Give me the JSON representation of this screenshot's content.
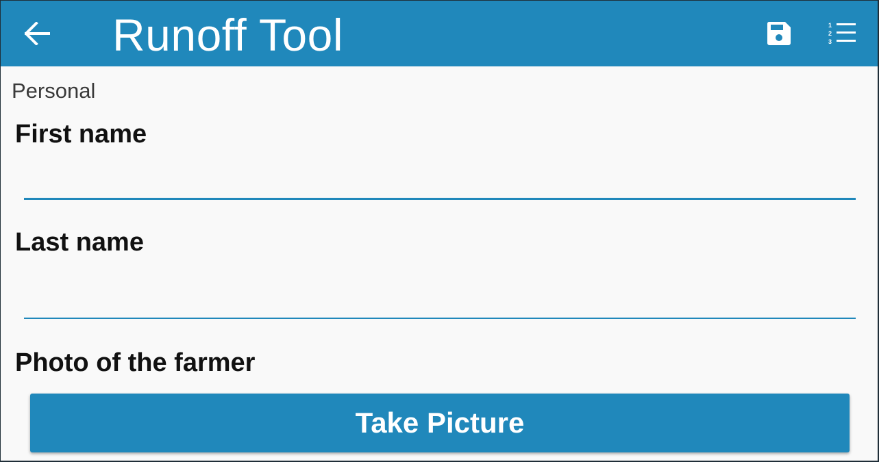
{
  "app_bar": {
    "title": "Runoff Tool",
    "back_icon": "arrow-left-icon",
    "save_icon": "save-icon",
    "list_icon": "numbered-list-icon",
    "color": "#2088bb"
  },
  "form": {
    "section": "Personal",
    "fields": [
      {
        "label": "First name",
        "value": ""
      },
      {
        "label": "Last name",
        "value": ""
      }
    ],
    "photo": {
      "label": "Photo of the farmer",
      "button_label": "Take Picture"
    }
  }
}
